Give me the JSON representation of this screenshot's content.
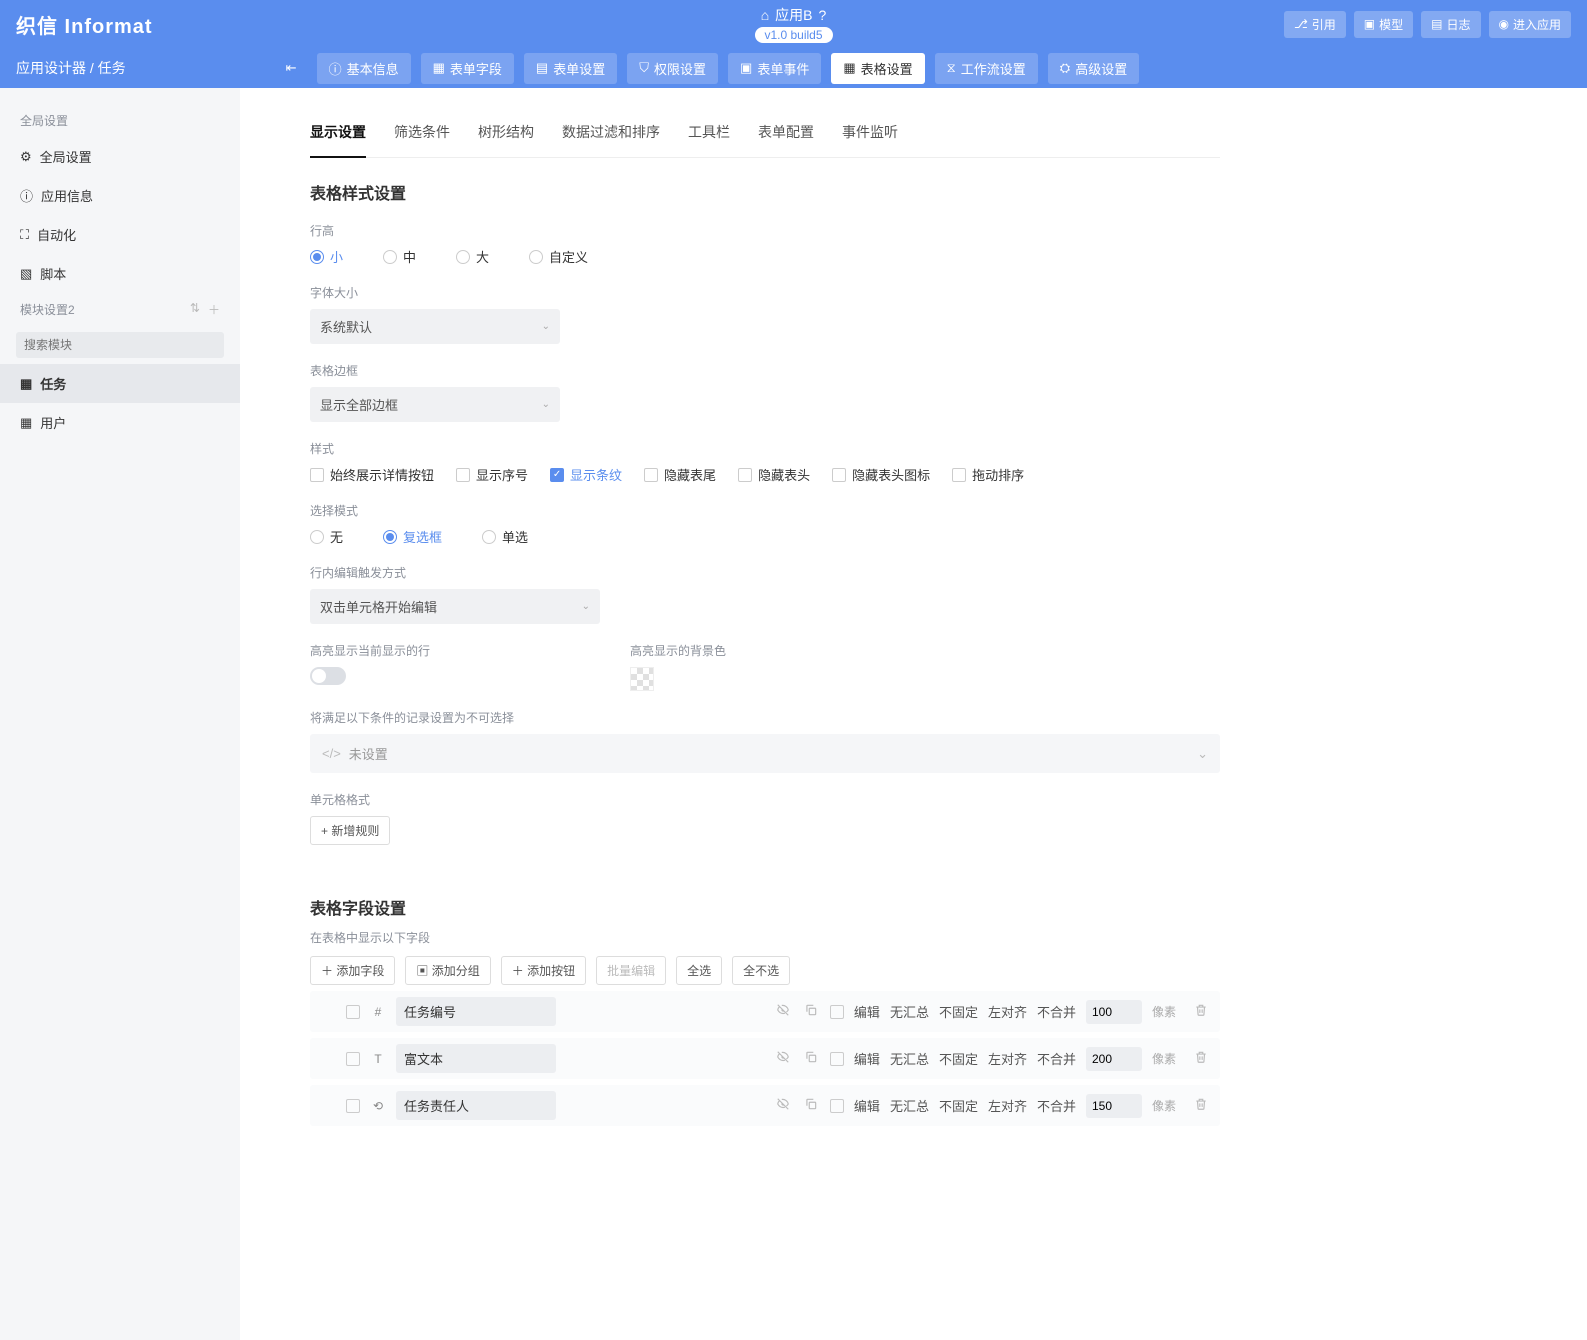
{
  "header": {
    "logo": "织信 Informat",
    "app_name": "应用B",
    "version": "v1.0 build5",
    "buttons": {
      "ref": "引用",
      "model": "模型",
      "log": "日志",
      "enter": "进入应用"
    }
  },
  "crumb": "应用设计器 / 任务",
  "tabs": [
    "基本信息",
    "表单字段",
    "表单设置",
    "权限设置",
    "表单事件",
    "表格设置",
    "工作流设置",
    "高级设置"
  ],
  "sidebar": {
    "sec_global": "全局设置",
    "global_items": [
      "全局设置",
      "应用信息",
      "自动化",
      "脚本"
    ],
    "sec_module": "模块设置2",
    "search_ph": "搜索模块",
    "modules": [
      "任务",
      "用户"
    ]
  },
  "subtabs": [
    "显示设置",
    "筛选条件",
    "树形结构",
    "数据过滤和排序",
    "工具栏",
    "表单配置",
    "事件监听"
  ],
  "style_heading": "表格样式设置",
  "row_height": {
    "label": "行高",
    "options": [
      "小",
      "中",
      "大",
      "自定义"
    ],
    "selected": 0
  },
  "font_size": {
    "label": "字体大小",
    "value": "系统默认"
  },
  "border": {
    "label": "表格边框",
    "value": "显示全部边框"
  },
  "style_opt": {
    "label": "样式",
    "items": [
      "始终展示详情按钮",
      "显示序号",
      "显示条纹",
      "隐藏表尾",
      "隐藏表头",
      "隐藏表头图标",
      "拖动排序"
    ],
    "checked": [
      2
    ]
  },
  "sel_mode": {
    "label": "选择模式",
    "options": [
      "无",
      "复选框",
      "单选"
    ],
    "selected": 1
  },
  "inline_edit": {
    "label": "行内编辑触发方式",
    "value": "双击单元格开始编辑"
  },
  "highlight_row": "高亮显示当前显示的行",
  "highlight_bg": "高亮显示的背景色",
  "cond_label": "将满足以下条件的记录设置为不可选择",
  "cond_value": "未设置",
  "cell_fmt": {
    "label": "单元格格式",
    "btn": "+  新增规则"
  },
  "field_heading": "表格字段设置",
  "field_sub": "在表格中显示以下字段",
  "field_actions": {
    "add_field": "添加字段",
    "add_group": "添加分组",
    "add_btn": "添加按钮",
    "batch": "批量编辑",
    "select_all": "全选",
    "deselect": "全不选"
  },
  "rows": [
    {
      "type": "#",
      "name": "任务编号",
      "width": "100"
    },
    {
      "type": "T",
      "name": "富文本",
      "width": "200"
    },
    {
      "type": "⟲",
      "name": "任务责任人",
      "width": "150"
    }
  ],
  "row_labels": {
    "edit": "编辑",
    "nosum": "无汇总",
    "nofix": "不固定",
    "align": "左对齐",
    "nomerge": "不合并",
    "unit": "像素"
  }
}
